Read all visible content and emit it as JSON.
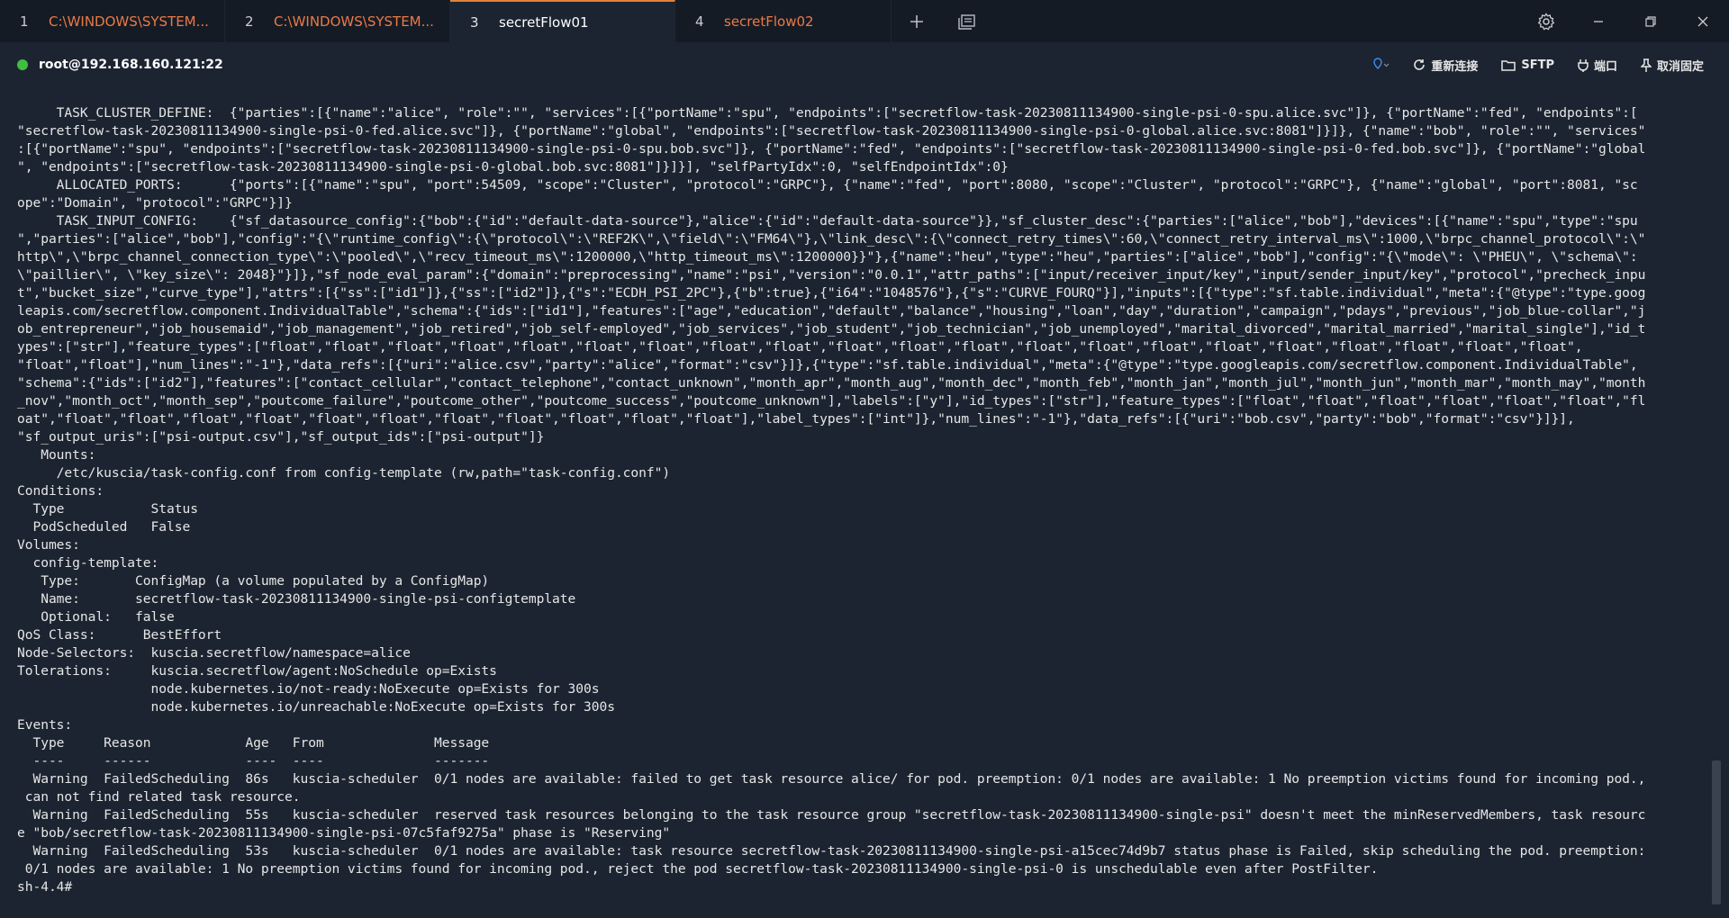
{
  "tabs": [
    {
      "num": "1",
      "label": "C:\\WINDOWS\\SYSTEM..."
    },
    {
      "num": "2",
      "label": "C:\\WINDOWS\\SYSTEM..."
    },
    {
      "num": "3",
      "label": "secretFlow01"
    },
    {
      "num": "4",
      "label": "secretFlow02"
    }
  ],
  "session": {
    "host": "root@192.168.160.121:22",
    "actions": {
      "reconnect": "重新连接",
      "sftp": "SFTP",
      "port": "端口",
      "unpin": "取消固定"
    }
  },
  "colors": {
    "accent": "#e2823b",
    "status_connected": "#3fbf3f",
    "tab_inactive_text": "#ea7a45",
    "background": "#1c2431"
  },
  "icons": [
    "add-tab-icon",
    "tab-overview-icon",
    "gear-icon",
    "minimize-icon",
    "maximize-icon",
    "close-icon",
    "pin-icon",
    "refresh-icon",
    "folder-icon",
    "plug-icon",
    "unpin-icon"
  ],
  "terminal": {
    "lines": [
      "     TASK_CLUSTER_DEFINE:  {\"parties\":[{\"name\":\"alice\", \"role\":\"\", \"services\":[{\"portName\":\"spu\", \"endpoints\":[\"secretflow-task-20230811134900-single-psi-0-spu.alice.svc\"]}, {\"portName\":\"fed\", \"endpoints\":[",
      "\"secretflow-task-20230811134900-single-psi-0-fed.alice.svc\"]}, {\"portName\":\"global\", \"endpoints\":[\"secretflow-task-20230811134900-single-psi-0-global.alice.svc:8081\"]}]}, {\"name\":\"bob\", \"role\":\"\", \"services\"",
      ":[{\"portName\":\"spu\", \"endpoints\":[\"secretflow-task-20230811134900-single-psi-0-spu.bob.svc\"]}, {\"portName\":\"fed\", \"endpoints\":[\"secretflow-task-20230811134900-single-psi-0-fed.bob.svc\"]}, {\"portName\":\"global",
      "\", \"endpoints\":[\"secretflow-task-20230811134900-single-psi-0-global.bob.svc:8081\"]}]}], \"selfPartyIdx\":0, \"selfEndpointIdx\":0}",
      "     ALLOCATED_PORTS:      {\"ports\":[{\"name\":\"spu\", \"port\":54509, \"scope\":\"Cluster\", \"protocol\":\"GRPC\"}, {\"name\":\"fed\", \"port\":8080, \"scope\":\"Cluster\", \"protocol\":\"GRPC\"}, {\"name\":\"global\", \"port\":8081, \"sc",
      "ope\":\"Domain\", \"protocol\":\"GRPC\"}]}",
      "     TASK_INPUT_CONFIG:    {\"sf_datasource_config\":{\"bob\":{\"id\":\"default-data-source\"},\"alice\":{\"id\":\"default-data-source\"}},\"sf_cluster_desc\":{\"parties\":[\"alice\",\"bob\"],\"devices\":[{\"name\":\"spu\",\"type\":\"spu",
      "\",\"parties\":[\"alice\",\"bob\"],\"config\":\"{\\\"runtime_config\\\":{\\\"protocol\\\":\\\"REF2K\\\",\\\"field\\\":\\\"FM64\\\"},\\\"link_desc\\\":{\\\"connect_retry_times\\\":60,\\\"connect_retry_interval_ms\\\":1000,\\\"brpc_channel_protocol\\\":\\\"",
      "http\\\",\\\"brpc_channel_connection_type\\\":\\\"pooled\\\",\\\"recv_timeout_ms\\\":1200000,\\\"http_timeout_ms\\\":1200000}}\"},{\"name\":\"heu\",\"type\":\"heu\",\"parties\":[\"alice\",\"bob\"],\"config\":\"{\\\"mode\\\": \\\"PHEU\\\", \\\"schema\\\":",
      "\\\"paillier\\\", \\\"key_size\\\": 2048}\"}]},\"sf_node_eval_param\":{\"domain\":\"preprocessing\",\"name\":\"psi\",\"version\":\"0.0.1\",\"attr_paths\":[\"input/receiver_input/key\",\"input/sender_input/key\",\"protocol\",\"precheck_inpu",
      "t\",\"bucket_size\",\"curve_type\"],\"attrs\":[{\"ss\":[\"id1\"]},{\"ss\":[\"id2\"]},{\"s\":\"ECDH_PSI_2PC\"},{\"b\":true},{\"i64\":\"1048576\"},{\"s\":\"CURVE_FOURQ\"}],\"inputs\":[{\"type\":\"sf.table.individual\",\"meta\":{\"@type\":\"type.goog",
      "leapis.com/secretflow.component.IndividualTable\",\"schema\":{\"ids\":[\"id1\"],\"features\":[\"age\",\"education\",\"default\",\"balance\",\"housing\",\"loan\",\"day\",\"duration\",\"campaign\",\"pdays\",\"previous\",\"job_blue-collar\",\"j",
      "ob_entrepreneur\",\"job_housemaid\",\"job_management\",\"job_retired\",\"job_self-employed\",\"job_services\",\"job_student\",\"job_technician\",\"job_unemployed\",\"marital_divorced\",\"marital_married\",\"marital_single\"],\"id_t",
      "ypes\":[\"str\"],\"feature_types\":[\"float\",\"float\",\"float\",\"float\",\"float\",\"float\",\"float\",\"float\",\"float\",\"float\",\"float\",\"float\",\"float\",\"float\",\"float\",\"float\",\"float\",\"float\",\"float\",\"float\",\"float\",",
      "\"float\",\"float\"],\"num_lines\":\"-1\"},\"data_refs\":[{\"uri\":\"alice.csv\",\"party\":\"alice\",\"format\":\"csv\"}]},{\"type\":\"sf.table.individual\",\"meta\":{\"@type\":\"type.googleapis.com/secretflow.component.IndividualTable\",",
      "\"schema\":{\"ids\":[\"id2\"],\"features\":[\"contact_cellular\",\"contact_telephone\",\"contact_unknown\",\"month_apr\",\"month_aug\",\"month_dec\",\"month_feb\",\"month_jan\",\"month_jul\",\"month_jun\",\"month_mar\",\"month_may\",\"month",
      "_nov\",\"month_oct\",\"month_sep\",\"poutcome_failure\",\"poutcome_other\",\"poutcome_success\",\"poutcome_unknown\"],\"labels\":[\"y\"],\"id_types\":[\"str\"],\"feature_types\":[\"float\",\"float\",\"float\",\"float\",\"float\",\"float\",\"fl",
      "oat\",\"float\",\"float\",\"float\",\"float\",\"float\",\"float\",\"float\",\"float\",\"float\",\"float\",\"float\"],\"label_types\":[\"int\"]},\"num_lines\":\"-1\"},\"data_refs\":[{\"uri\":\"bob.csv\",\"party\":\"bob\",\"format\":\"csv\"}]}],",
      "\"sf_output_uris\":[\"psi-output.csv\"],\"sf_output_ids\":[\"psi-output\"]}",
      "   Mounts:",
      "     /etc/kuscia/task-config.conf from config-template (rw,path=\"task-config.conf\")",
      "Conditions:",
      "  Type           Status",
      "  PodScheduled   False",
      "Volumes:",
      "  config-template:",
      "   Type:       ConfigMap (a volume populated by a ConfigMap)",
      "   Name:       secretflow-task-20230811134900-single-psi-configtemplate",
      "   Optional:   false",
      "QoS Class:      BestEffort",
      "Node-Selectors:  kuscia.secretflow/namespace=alice",
      "Tolerations:     kuscia.secretflow/agent:NoSchedule op=Exists",
      "                 node.kubernetes.io/not-ready:NoExecute op=Exists for 300s",
      "                 node.kubernetes.io/unreachable:NoExecute op=Exists for 300s",
      "Events:",
      "  Type     Reason            Age   From              Message",
      "  ----     ------            ----  ----              -------",
      "  Warning  FailedScheduling  86s   kuscia-scheduler  0/1 nodes are available: failed to get task resource alice/ for pod. preemption: 0/1 nodes are available: 1 No preemption victims found for incoming pod.,",
      " can not find related task resource.",
      "  Warning  FailedScheduling  55s   kuscia-scheduler  reserved task resources belonging to the task resource group \"secretflow-task-20230811134900-single-psi\" doesn't meet the minReservedMembers, task resourc",
      "e \"bob/secretflow-task-20230811134900-single-psi-07c5faf9275a\" phase is \"Reserving\"",
      "  Warning  FailedScheduling  53s   kuscia-scheduler  0/1 nodes are available: task resource secretflow-task-20230811134900-single-psi-a15cec74d9b7 status phase is Failed, skip scheduling the pod. preemption:",
      " 0/1 nodes are available: 1 No preemption victims found for incoming pod., reject the pod secretflow-task-20230811134900-single-psi-0 is unschedulable even after PostFilter.",
      "sh-4.4#"
    ]
  }
}
